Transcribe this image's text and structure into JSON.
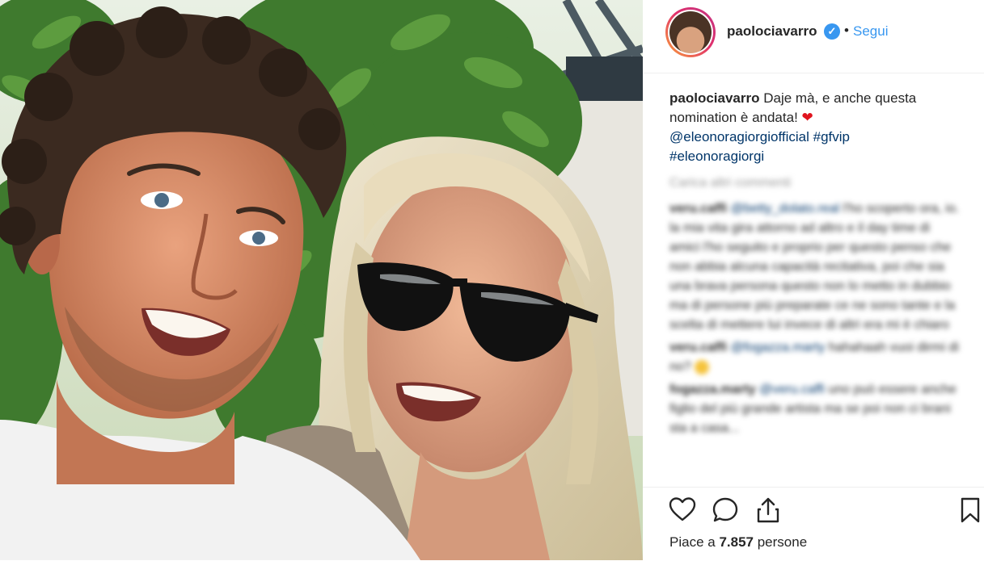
{
  "post": {
    "username": "paolociavarro",
    "follow_label": "Segui",
    "separator": "•",
    "verified_glyph": "✓"
  },
  "caption": {
    "username": "paolociavarro",
    "text": "Daje mà, e anche questa nomination è andata!",
    "emoji": "❤",
    "mention": "@eleonoragiorgiofficial",
    "hashtag1": "#gfvip",
    "hashtag2": "#eleonoragiorgi"
  },
  "comments": {
    "load_more": "Carica altri commenti",
    "items": [
      {
        "username": "veru.caffi",
        "mention": "@betty_dolato.real",
        "text": "l'ho scoperto ora, io. la mia vita gira attorno ad altro e il day time di amici l'ho seguito e proprio per questo penso che non abbia alcuna capacità recitativa, poi che sia una brava persona questo non lo metto in dubbio ma di persone più preparate ce ne sono tante e la scelta di mettere lui invece di altri era mi è chiaro"
      },
      {
        "username": "veru.caffi",
        "mention": "@fogazza.marty",
        "text": "hahahaah vuoi dirmi di no?"
      },
      {
        "username": "fogazza.marty",
        "mention": "@veru.caffi",
        "text": "uno può essere anche figlio del più grande artista ma se poi non ci brani sta a casa..."
      }
    ]
  },
  "actions": {
    "like_icon": "heart-outline-icon",
    "comment_icon": "comment-bubble-icon",
    "share_icon": "share-upload-icon",
    "save_icon": "bookmark-icon"
  },
  "likes": {
    "prefix": "Piace a",
    "count": "7.857",
    "suffix": "persone"
  },
  "colors": {
    "accent": "#3897f0",
    "link": "#003569",
    "heart": "#e0141e",
    "border": "#efefef"
  }
}
